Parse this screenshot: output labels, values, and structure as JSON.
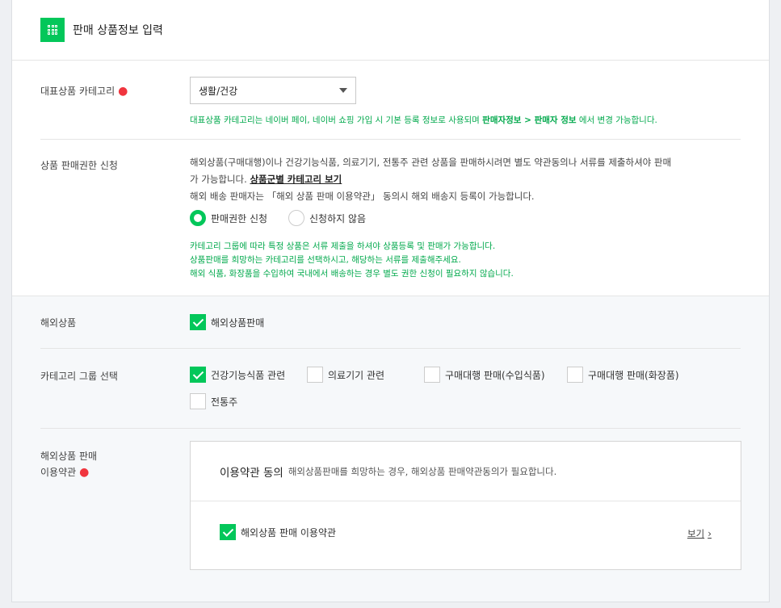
{
  "header": {
    "title": "판매 상품정보 입력"
  },
  "category": {
    "label": "대표상품 카테고리",
    "required_mark": "●",
    "selected": "생활/건강",
    "notice_prefix": "대표상품 카테고리는 네이버 페이, 네이버 쇼핑 가입 시 기본 등록 정보로 사용되며 ",
    "notice_link": "판매자정보 > 판매자 정보",
    "notice_suffix": " 에서 변경 가능합니다."
  },
  "permission": {
    "label": "상품 판매권한 신청",
    "desc_line1": "해외상품(구매대행)이나 건강기능식품, 의료기기, 전통주 관련 상품을 판매하시려면 별도 약관동의나 서류를 제출하셔야 판매",
    "desc_line2": "가 가능합니다. ",
    "desc_link": "상품군별 카테고리 보기",
    "desc_line3": "해외 배송 판매자는 「해외 상품 판매 이용약관」 동의시 해외 배송지 등록이 가능합니다.",
    "options": [
      "판매권한 신청",
      "신청하지 않음"
    ],
    "selected_index": 0,
    "notes": [
      "카테고리 그룹에 따라 특정 상품은 서류 제출을 하셔야 상품등록 및 판매가 가능합니다.",
      "상품판매를 희망하는 카테고리를 선택하시고, 해당하는 서류를 제출해주세요.",
      "해외 식품, 화장품을 수입하여 국내에서 배송하는 경우 별도 권한 신청이 필요하지 않습니다."
    ]
  },
  "overseas": {
    "label": "해외상품",
    "checkbox_label": "해외상품판매",
    "checked": true
  },
  "category_group": {
    "label": "카테고리 그룹 선택",
    "items": [
      {
        "label": "건강기능식품 관련",
        "checked": true
      },
      {
        "label": "의료기기 관련",
        "checked": false
      },
      {
        "label": "구매대행 판매(수입식품)",
        "checked": false
      },
      {
        "label": "구매대행 판매(화장품)",
        "checked": false
      },
      {
        "label": "전통주",
        "checked": false
      }
    ]
  },
  "terms": {
    "label_line1": "해외상품 판매",
    "label_line2": "이용약관",
    "required_mark": "●",
    "title": "이용약관 동의",
    "description": "해외상품판매를 희망하는 경우, 해외상품 판매약관동의가 필요합니다.",
    "checkbox_label": "해외상품 판매 이용약관",
    "checked": true,
    "view_label": "보기",
    "view_chevron": "›"
  },
  "colors": {
    "accent": "#03c75a",
    "required": "#f0353e",
    "notice": "#03a94d"
  }
}
